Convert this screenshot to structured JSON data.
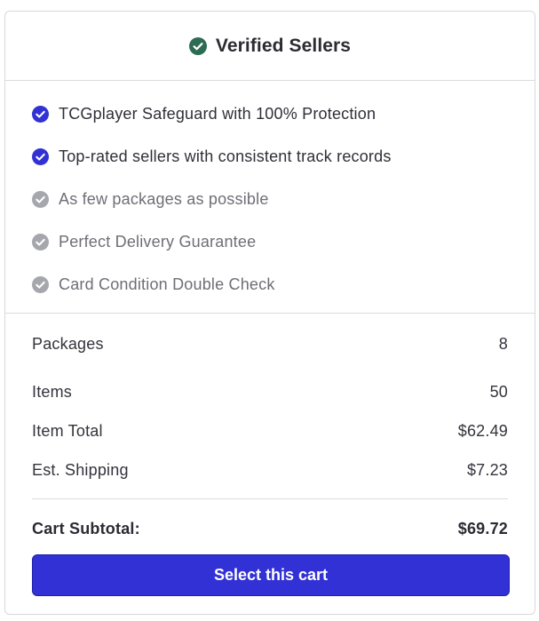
{
  "header": {
    "title": "Verified Sellers",
    "icon": "check-circle-icon",
    "icon_color": "#2e6b55"
  },
  "features": [
    {
      "label": "TCGplayer Safeguard with 100% Protection",
      "included": true
    },
    {
      "label": "Top-rated sellers with consistent track records",
      "included": true
    },
    {
      "label": "As few packages as possible",
      "included": false
    },
    {
      "label": "Perfect Delivery Guarantee",
      "included": false
    },
    {
      "label": "Card Condition Double Check",
      "included": false
    }
  ],
  "summary": {
    "packages_label": "Packages",
    "packages_value": "8",
    "items_label": "Items",
    "items_value": "50",
    "item_total_label": "Item Total",
    "item_total_value": "$62.49",
    "shipping_label": "Est. Shipping",
    "shipping_value": "$7.23",
    "subtotal_label": "Cart Subtotal:",
    "subtotal_value": "$69.72"
  },
  "button": {
    "label": "Select this cart"
  },
  "colors": {
    "included_check": "#3232d4",
    "excluded_check": "#a6a6ad",
    "button_bg": "#3131d6"
  }
}
